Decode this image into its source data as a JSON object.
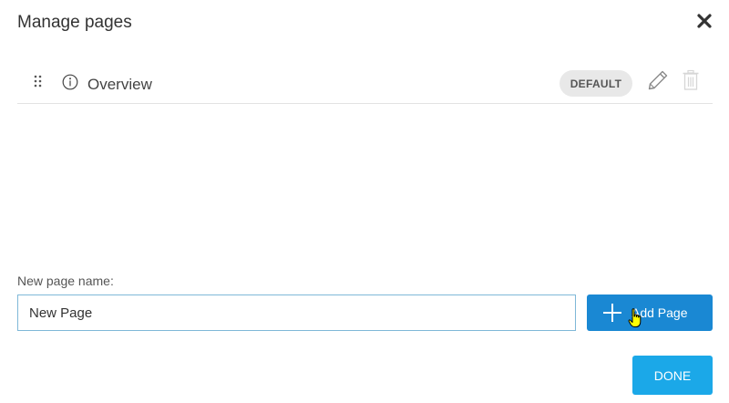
{
  "dialog": {
    "title": "Manage pages",
    "close_icon": "close-icon"
  },
  "pages": [
    {
      "name": "Overview",
      "badge": "DEFAULT",
      "icons": [
        "drag-handle-icon",
        "info-icon",
        "pencil-icon",
        "trash-icon"
      ]
    }
  ],
  "new_page": {
    "label": "New page name:",
    "value": "New Page"
  },
  "buttons": {
    "add_label": "Add Page",
    "done_label": "DONE"
  },
  "colors": {
    "add_button": "#1a88d3",
    "done_button": "#1ba8e8",
    "input_border": "#7fb8d8",
    "badge_background": "#e8e8e8"
  }
}
